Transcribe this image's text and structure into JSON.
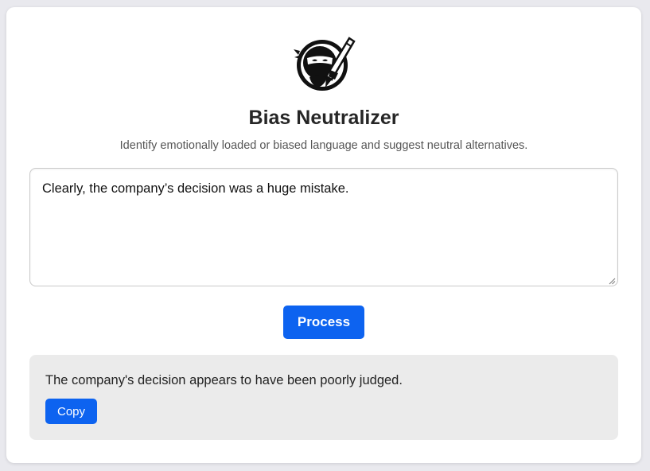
{
  "app": {
    "title": "Bias Neutralizer",
    "subtitle": "Identify emotionally loaded or biased language and suggest neutral alternatives.",
    "logo_icon": "ninja-writer-icon"
  },
  "input": {
    "value": "Clearly, the company’s decision was a huge mistake."
  },
  "actions": {
    "process_label": "Process"
  },
  "output": {
    "text": "The company's decision appears to have been poorly judged.",
    "copy_label": "Copy"
  },
  "colors": {
    "accent": "#0d63f0",
    "background": "#e9e9ee",
    "card": "#ffffff",
    "output_background": "#ebebeb"
  }
}
